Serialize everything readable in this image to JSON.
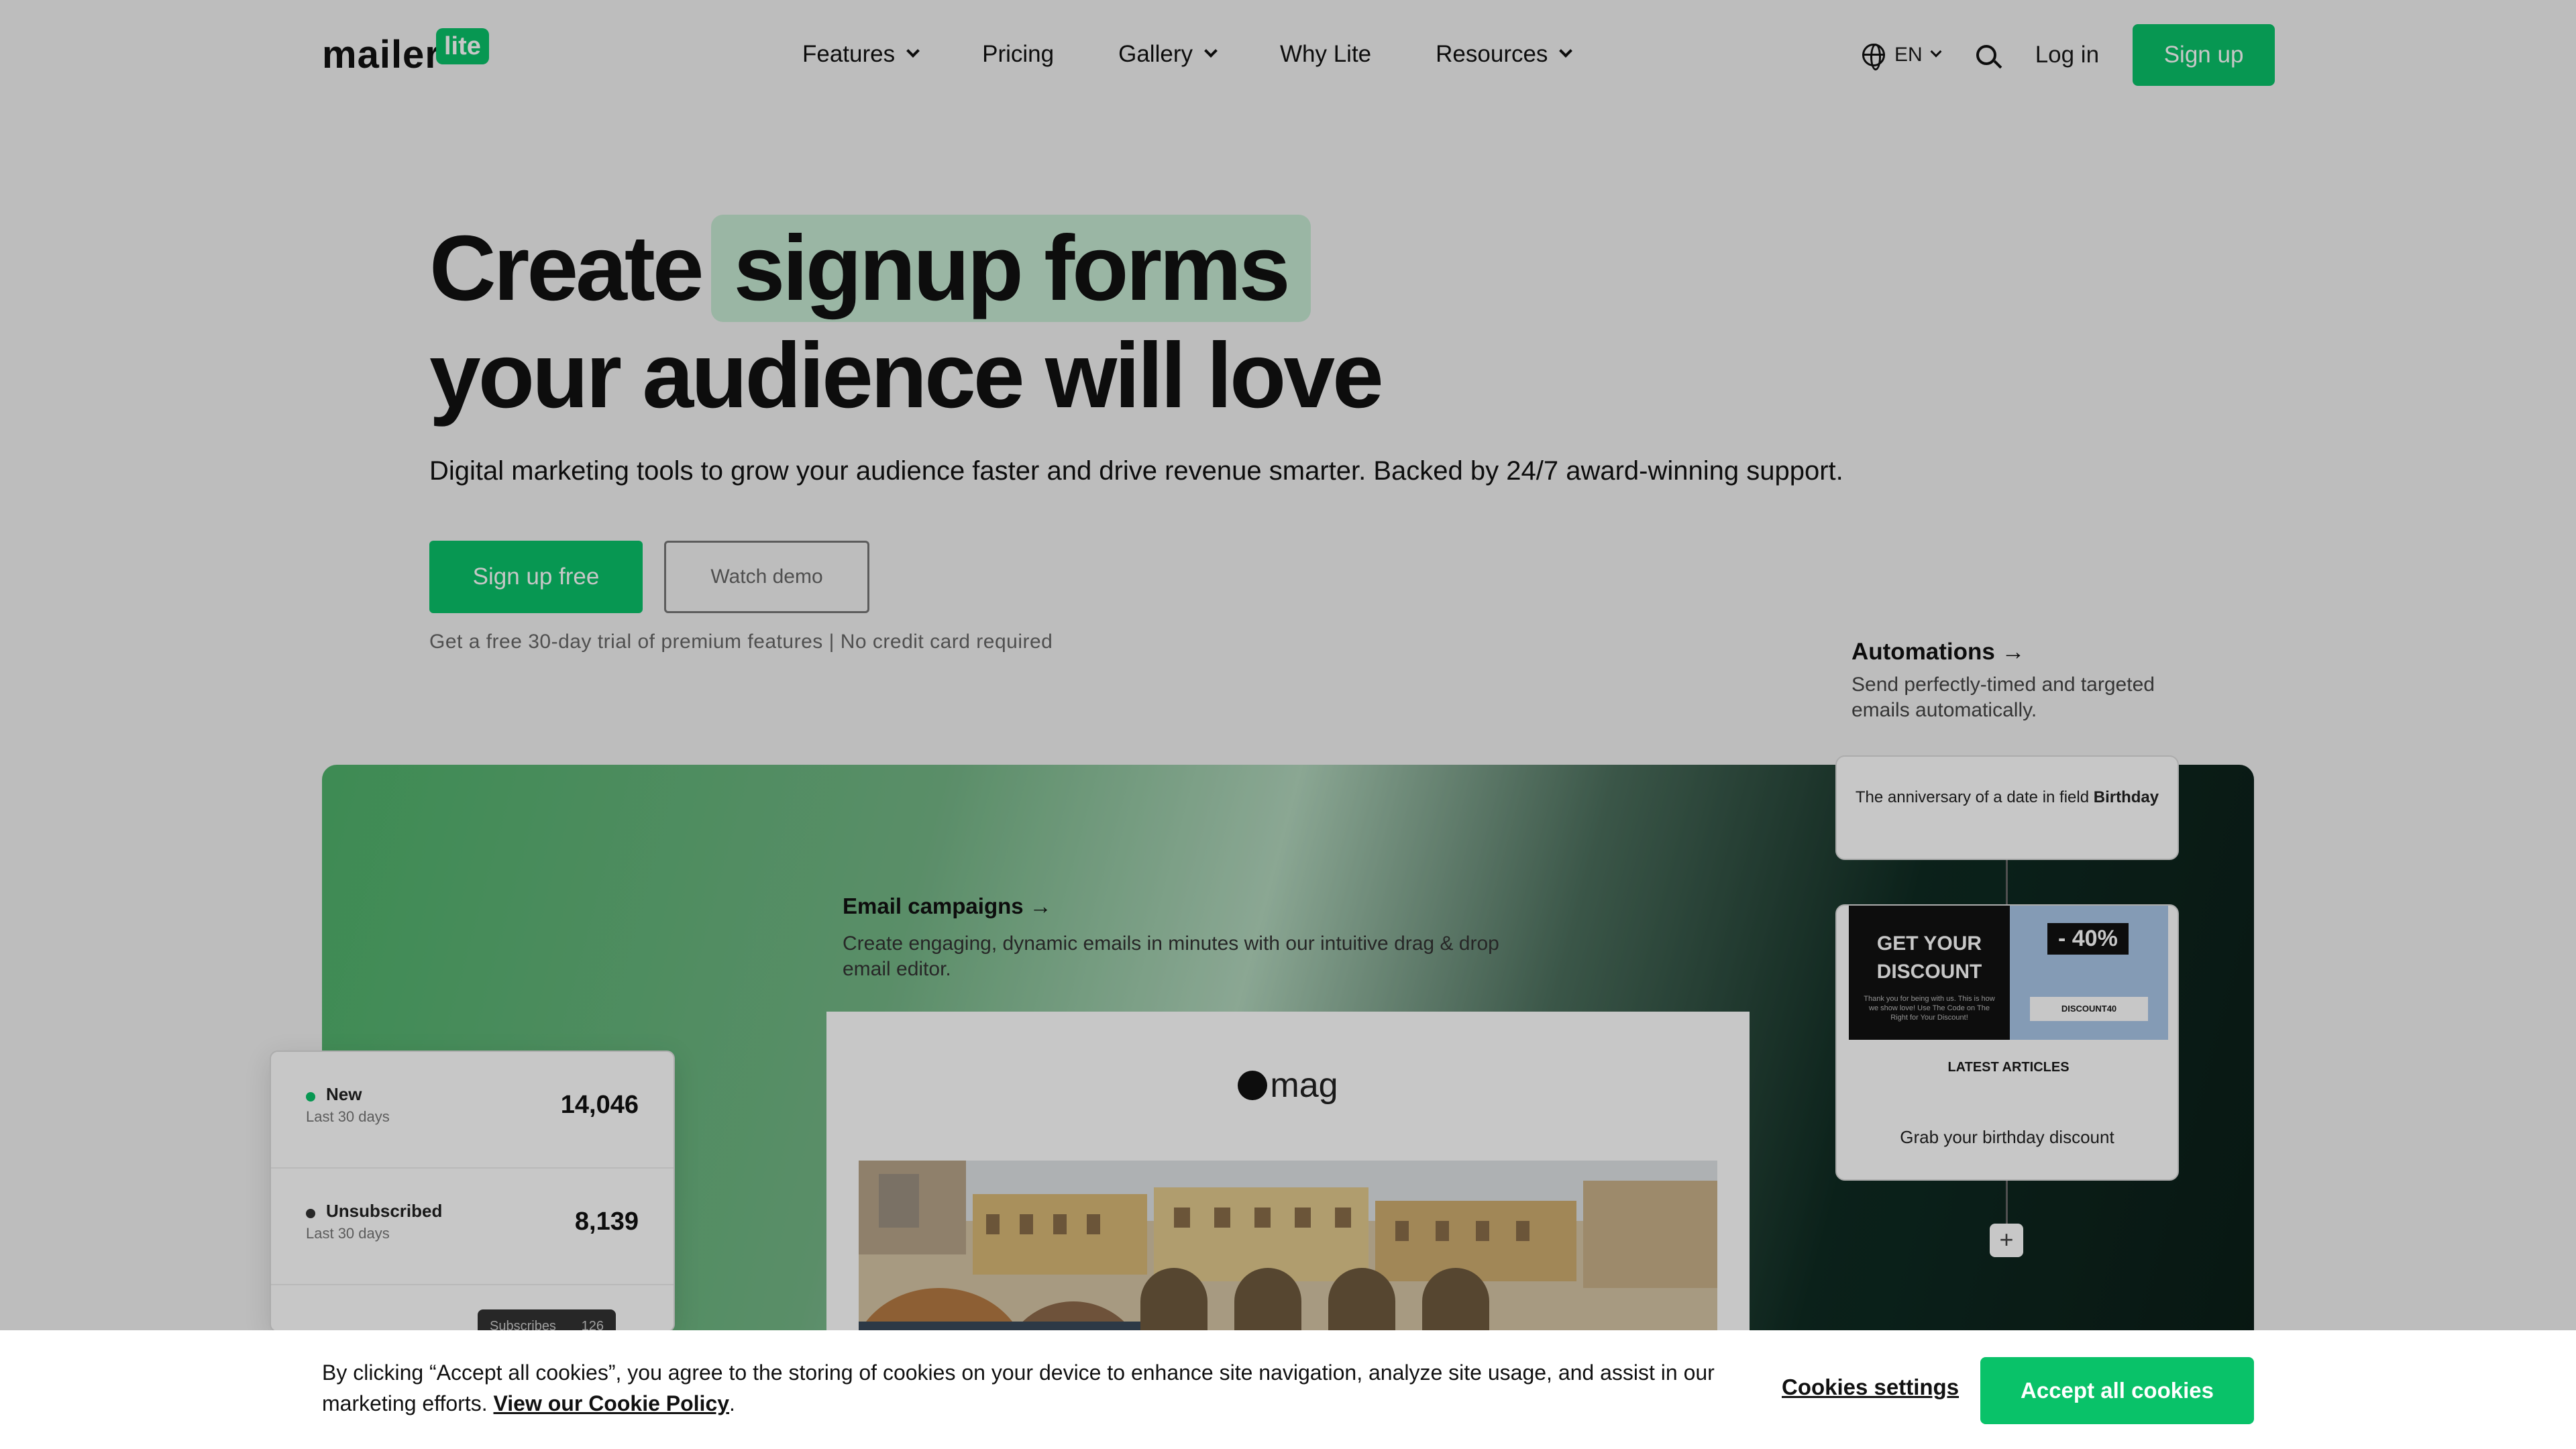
{
  "header": {
    "logo_word": "mailer",
    "logo_badge": "lite",
    "nav": [
      {
        "label": "Features",
        "dropdown": true
      },
      {
        "label": "Pricing",
        "dropdown": false
      },
      {
        "label": "Gallery",
        "dropdown": true
      },
      {
        "label": "Why Lite",
        "dropdown": false
      },
      {
        "label": "Resources",
        "dropdown": true
      }
    ],
    "language": "EN",
    "login": "Log in",
    "signup": "Sign up"
  },
  "hero": {
    "title_part1": "Create",
    "title_highlight": "signup forms",
    "title_line2": "your audience will love",
    "subtitle": "Digital marketing tools to grow your audience faster and drive revenue smarter. Backed by 24/7 award-winning support.",
    "primary_button": "Sign up free",
    "secondary_button": "Watch demo",
    "trial_note": "Get a free 30-day trial of premium features | No credit card required"
  },
  "email_campaigns": {
    "title": "Email campaigns →",
    "description": "Create engaging, dynamic emails in minutes with our intuitive drag & drop email editor.",
    "preview_logo": "mag"
  },
  "stats": [
    {
      "name": "New",
      "period": "Last 30 days",
      "value": "14,046",
      "color": "#09c269"
    },
    {
      "name": "Unsubscribed",
      "period": "Last 30 days",
      "value": "8,139",
      "color": "#333333"
    }
  ],
  "tooltip": {
    "label": "Subscribes",
    "value": "126"
  },
  "automations": {
    "title": "Automations →",
    "description": "Send perfectly-timed and targeted emails automatically.",
    "trigger_text": "The anniversary of a date in field",
    "trigger_field": "Birthday",
    "promo_headline": "GET YOUR DISCOUNT",
    "promo_small": "Thank you for being with us. This is how we show love! Use The Code on The Right for Your Discount!",
    "promo_percent": "- 40%",
    "promo_code": "DISCOUNT40",
    "latest_articles": "LATEST ARTICLES",
    "email_label": "Grab your birthday discount",
    "add_step": "+"
  },
  "cookie": {
    "text": "By clicking “Accept all cookies”, you agree to the storing of cookies on your device to enhance site navigation, analyze site usage, and assist in our marketing efforts.",
    "policy_link": "View our Cookie Policy",
    "settings": "Cookies settings",
    "accept": "Accept all cookies"
  },
  "colors": {
    "brand_green": "#09c269",
    "highlight": "#c6e9d3"
  }
}
